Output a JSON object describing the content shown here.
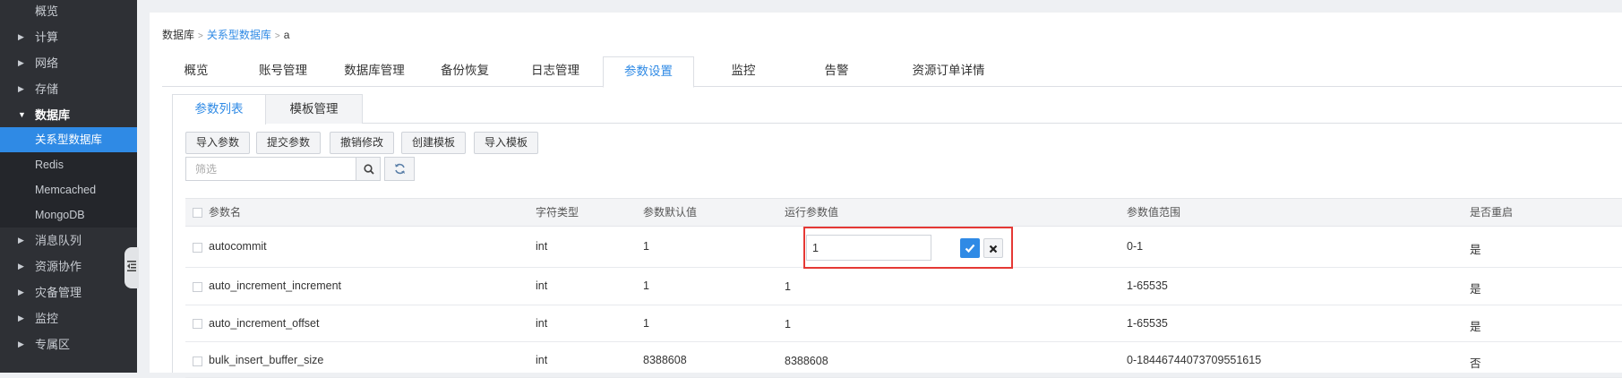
{
  "sidebar": {
    "items": [
      {
        "label": "概览",
        "expandable": false
      },
      {
        "label": "计算",
        "expandable": true
      },
      {
        "label": "网络",
        "expandable": true
      },
      {
        "label": "存储",
        "expandable": true
      },
      {
        "label": "数据库",
        "expandable": true,
        "open": true
      },
      {
        "label": "消息队列",
        "expandable": true
      },
      {
        "label": "资源协作",
        "expandable": true
      },
      {
        "label": "灾备管理",
        "expandable": true
      },
      {
        "label": "监控",
        "expandable": true
      },
      {
        "label": "专属区",
        "expandable": true
      }
    ],
    "database_children": [
      "关系型数据库",
      "Redis",
      "Memcached",
      "MongoDB"
    ],
    "active_child": "关系型数据库"
  },
  "breadcrumb": {
    "root": "数据库",
    "parent": "关系型数据库",
    "current": "a",
    "separator": ">"
  },
  "tabs": [
    "概览",
    "账号管理",
    "数据库管理",
    "备份恢复",
    "日志管理",
    "参数设置",
    "监控",
    "告警",
    "资源订单详情"
  ],
  "active_tab": "参数设置",
  "subtabs": [
    "参数列表",
    "模板管理"
  ],
  "active_subtab": "参数列表",
  "toolbar": {
    "import_params": "导入参数",
    "submit_params": "提交参数",
    "undo_changes": "撤销修改",
    "create_template": "创建模板",
    "import_template": "导入模板"
  },
  "search": {
    "placeholder": "筛选",
    "value": ""
  },
  "table": {
    "columns": [
      "参数名",
      "字符类型",
      "参数默认值",
      "运行参数值",
      "参数值范围",
      "是否重启"
    ],
    "rows": [
      {
        "name": "autocommit",
        "type": "int",
        "default": "1",
        "running": "1",
        "range": "0-1",
        "restart": "是",
        "editing": true
      },
      {
        "name": "auto_increment_increment",
        "type": "int",
        "default": "1",
        "running": "1",
        "range": "1-65535",
        "restart": "是"
      },
      {
        "name": "auto_increment_offset",
        "type": "int",
        "default": "1",
        "running": "1",
        "range": "1-65535",
        "restart": "是"
      },
      {
        "name": "bulk_insert_buffer_size",
        "type": "int",
        "default": "8388608",
        "running": "8388608",
        "range": "0-18446744073709551615",
        "restart": "否"
      }
    ]
  },
  "colors": {
    "accent": "#2f8ae5",
    "sidebar_bg": "#2e3035",
    "highlight_border": "#e53935"
  }
}
